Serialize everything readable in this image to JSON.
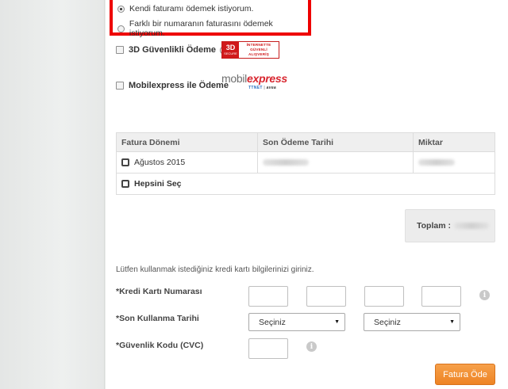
{
  "payment_options": {
    "own_bill": "Kendi faturamı ödemek istiyorum.",
    "other_number": "Farklı bir numaranın faturasını ödemek istiyorum."
  },
  "secure_payment": {
    "label": "3D Güvenlikli Ödeme",
    "badge_big": "3D",
    "badge_small": "SECURE",
    "badge_lines": [
      "İNTERNETTE",
      "GÜVENLİ",
      "ALIŞVERİŞ"
    ]
  },
  "mobilexpress": {
    "label": "Mobilexpress ile Ödeme",
    "logo_part1": "mobil",
    "logo_part2": "express",
    "operator1": "TTNET",
    "operator2": "avea"
  },
  "table": {
    "headers": [
      "Fatura Dönemi",
      "Son Ödeme Tarihi",
      "Miktar"
    ],
    "rows": [
      {
        "period": "Ağustos 2015"
      }
    ],
    "select_all": "Hepsini Seç"
  },
  "total": {
    "label": "Toplam :"
  },
  "form": {
    "instruction": "Lütfen kullanmak istediğiniz kredi kartı bilgilerinizi giriniz.",
    "card_number_label": "*Kredi Kartı Numarası",
    "expiry_label": "*Son Kullanma Tarihi",
    "cvc_label": "*Güvenlik Kodu (CVC)",
    "month_select": "Seçiniz",
    "year_select": "Seçiniz"
  },
  "actions": {
    "pay_button": "Fatura Öde"
  },
  "colors": {
    "highlight": "#ee0000",
    "accent_orange": "#ee8424",
    "brand_red": "#d0191b"
  }
}
